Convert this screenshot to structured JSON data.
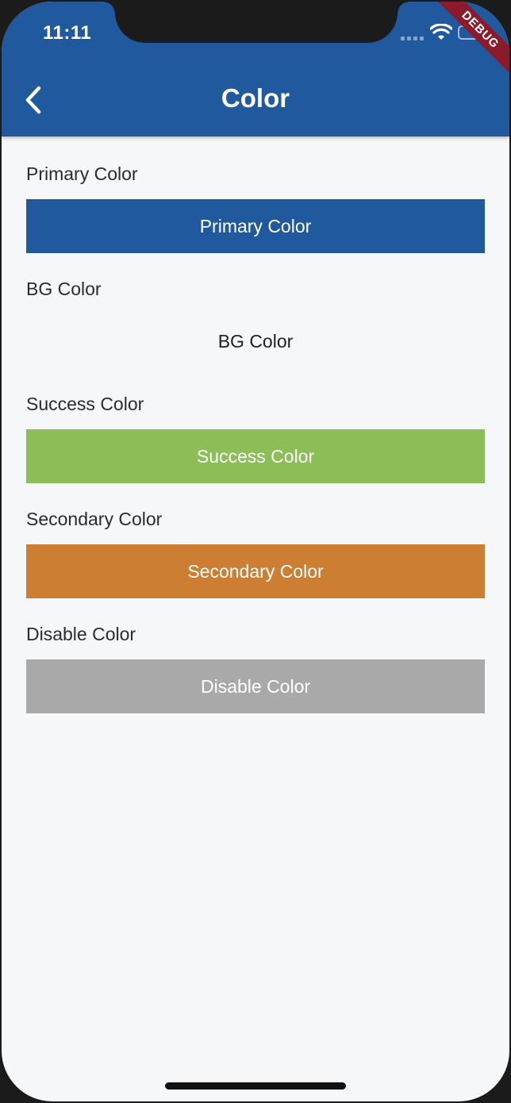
{
  "status_bar": {
    "time": "11:11",
    "debug_banner": "DEBUG"
  },
  "app_bar": {
    "title": "Color",
    "color": "#21599e"
  },
  "sections": [
    {
      "label": "Primary Color",
      "button_label": "Primary Color",
      "color": "#21599e",
      "text_color": "#ffffff"
    },
    {
      "label": "BG Color",
      "button_label": "BG Color",
      "color": "#f5f7f9",
      "text_color": "#1f1f1f"
    },
    {
      "label": "Success Color",
      "button_label": "Success Color",
      "color": "#8bbe57",
      "text_color": "#ffffff"
    },
    {
      "label": "Secondary Color",
      "button_label": "Secondary Color",
      "color": "#cc7f33",
      "text_color": "#ffffff"
    },
    {
      "label": "Disable Color",
      "button_label": "Disable Color",
      "color": "#a9a9a9",
      "text_color": "#ffffff"
    }
  ],
  "icons": {
    "back": "chevron-left-icon",
    "wifi": "wifi-icon",
    "battery": "battery-icon",
    "signal": "signal-icon"
  }
}
